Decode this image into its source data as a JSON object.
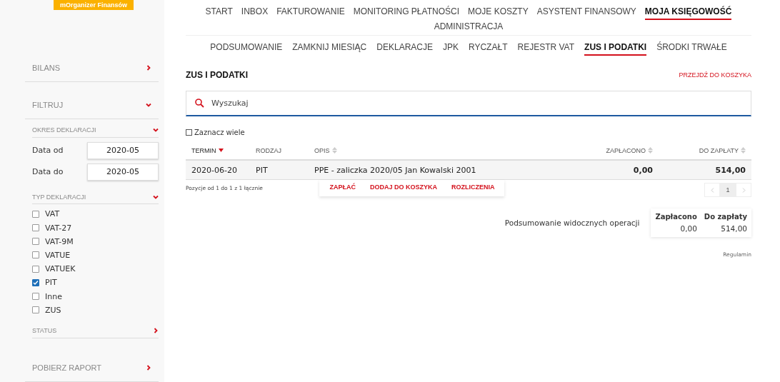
{
  "brand": "mOrganizer Finansów",
  "sidebar": {
    "sections": [
      {
        "label": "BILANS",
        "expanded": false
      },
      {
        "label": "FILTRUJ",
        "expanded": true
      }
    ],
    "filters": {
      "period": {
        "label": "OKRES DEKLARACJI",
        "expanded": true,
        "fields": [
          {
            "label": "Data od",
            "value": "2020-05"
          },
          {
            "label": "Data do",
            "value": "2020-05"
          }
        ]
      },
      "types": {
        "label": "TYP DEKLARACJI",
        "expanded": true,
        "items": [
          {
            "label": "VAT",
            "checked": false
          },
          {
            "label": "VAT-27",
            "checked": false
          },
          {
            "label": "VAT-9M",
            "checked": false
          },
          {
            "label": "VATUE",
            "checked": false
          },
          {
            "label": "VATUEK",
            "checked": false
          },
          {
            "label": "PIT",
            "checked": true
          },
          {
            "label": "Inne",
            "checked": false
          },
          {
            "label": "ZUS",
            "checked": false
          }
        ]
      },
      "status": {
        "label": "STATUS",
        "expanded": false
      }
    },
    "report": {
      "label": "POBIERZ RAPORT",
      "expanded": false
    }
  },
  "main_nav": [
    {
      "label": "START",
      "selected": false
    },
    {
      "label": "INBOX",
      "selected": false
    },
    {
      "label": "FAKTUROWANIE",
      "selected": false
    },
    {
      "label": "MONITORING PŁATNOŚCI",
      "selected": false
    },
    {
      "label": "MOJE KOSZTY",
      "selected": false
    },
    {
      "label": "ASYSTENT FINANSOWY",
      "selected": false
    },
    {
      "label": "MOJA KSIĘGOWOŚĆ",
      "selected": true
    },
    {
      "label": "ADMINISTRACJA",
      "selected": false
    }
  ],
  "sub_nav": [
    {
      "label": "PODSUMOWANIE",
      "selected": false
    },
    {
      "label": "ZAMKNIJ MIESIĄC",
      "selected": false
    },
    {
      "label": "DEKLARACJE",
      "selected": false
    },
    {
      "label": "JPK",
      "selected": false
    },
    {
      "label": "RYCZAŁT",
      "selected": false
    },
    {
      "label": "REJESTR VAT",
      "selected": false
    },
    {
      "label": "ZUS I PODATKI",
      "selected": true
    },
    {
      "label": "ŚRODKI TRWAŁE",
      "selected": false
    }
  ],
  "page_title": "ZUS I PODATKI",
  "cart_link": "PRZEJDŹ DO KOSZYKA",
  "search": {
    "placeholder": "Wyszukaj"
  },
  "select_many": {
    "label": "Zaznacz wiele",
    "checked": false
  },
  "table": {
    "columns": [
      {
        "label": "TERMIN",
        "sortable": true,
        "sorted": true,
        "right_aligned": false
      },
      {
        "label": "RODZAJ",
        "sortable": false,
        "sorted": false,
        "right_aligned": false
      },
      {
        "label": "OPIS",
        "sortable": true,
        "sorted": false,
        "right_aligned": false
      },
      {
        "label": "ZAPŁACONO",
        "sortable": true,
        "sorted": false,
        "right_aligned": true
      },
      {
        "label": "DO ZAPŁATY",
        "sortable": true,
        "sorted": false,
        "right_aligned": true
      }
    ],
    "rows": [
      [
        "2020-06-20",
        "PIT",
        "PPE - zaliczka 2020/05 Jan Kowalski 2001",
        "0,00",
        "514,00"
      ]
    ]
  },
  "row_actions": [
    "ZAPŁAĆ",
    "DODAJ DO KOSZYKA",
    "ROZLICZENIA"
  ],
  "pagination_info": "Pozycje od 1 do 1 z 1 łącznie",
  "pages": [
    {
      "label": "1",
      "selected": true
    }
  ],
  "summary": {
    "label": "Podsumowanie widocznych operacji",
    "headers": [
      "Zapłacono",
      "Do zapłaty"
    ],
    "values": [
      "0,00",
      "514,00"
    ]
  },
  "footer_link": "Regulamin"
}
